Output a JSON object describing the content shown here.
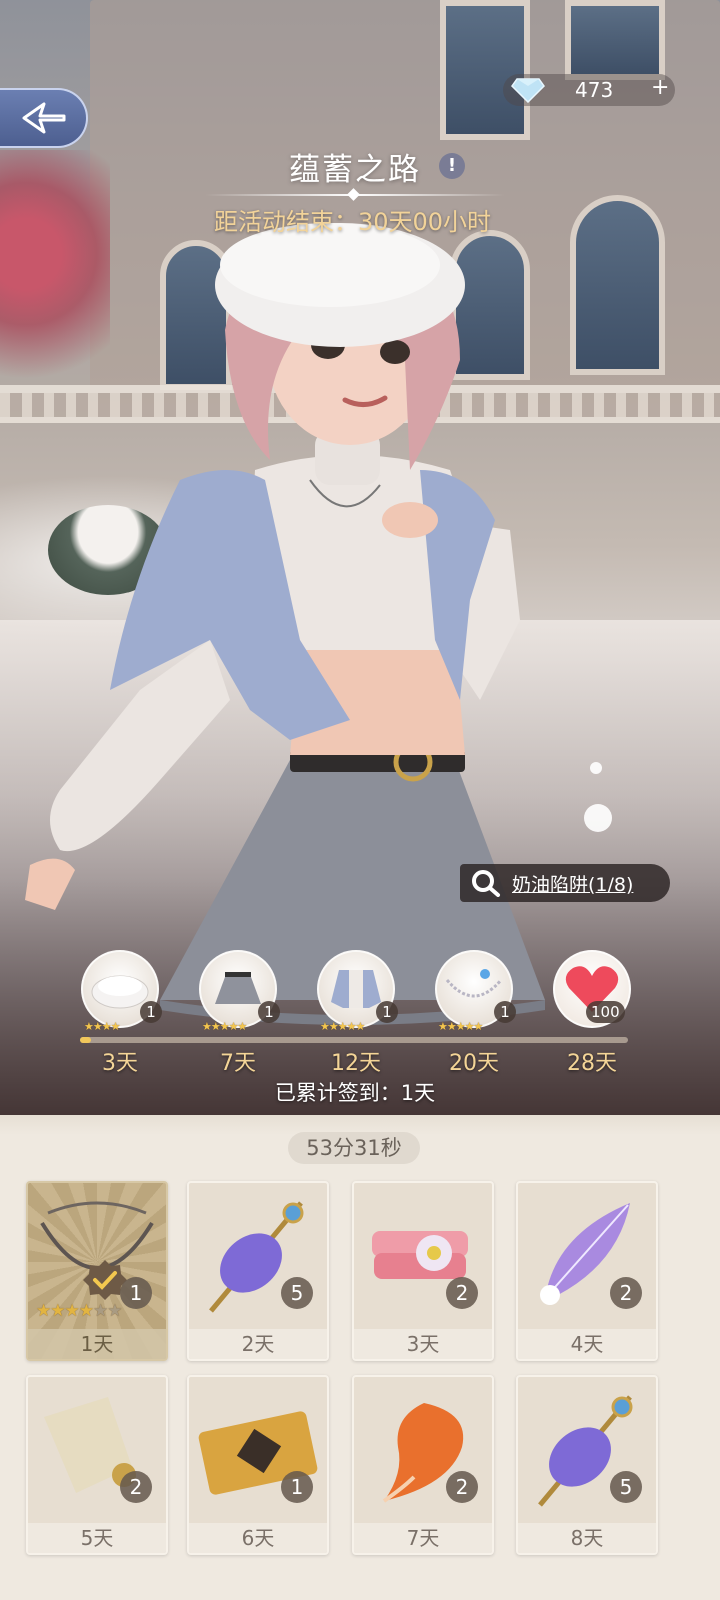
{
  "header": {
    "back_icon": "back-arrow-icon",
    "currency": {
      "icon": "diamond-icon",
      "amount": "473",
      "plus": "+"
    },
    "title": "蕴蓄之路",
    "info_icon": "!",
    "countdown": "距活动结束：30天00小时"
  },
  "item_hint": {
    "icon": "search-icon",
    "text": "奶油陷阱(1/8)"
  },
  "reward_track": {
    "progress": 0.02,
    "rewards": [
      {
        "item": "white-beret",
        "count": "1",
        "day": "3天"
      },
      {
        "item": "grey-skirt",
        "count": "1",
        "day": "7天"
      },
      {
        "item": "blue-cardigan",
        "count": "1",
        "day": "12天"
      },
      {
        "item": "necklace",
        "count": "1",
        "day": "20天"
      },
      {
        "item": "heart",
        "count": "100",
        "day": "28天"
      }
    ],
    "cumulative": "已累计签到：1天"
  },
  "panel": {
    "timer": "53分31秒",
    "cards": [
      {
        "item": "necklace",
        "qty": "1",
        "day": "1天",
        "claimed": true,
        "stars": 4
      },
      {
        "item": "purple-yarn-spindle",
        "qty": "5",
        "day": "2天"
      },
      {
        "item": "pink-fabric-flower",
        "qty": "2",
        "day": "3天"
      },
      {
        "item": "purple-feather",
        "qty": "2",
        "day": "4天"
      },
      {
        "item": "silk-scroll",
        "qty": "2",
        "day": "5天"
      },
      {
        "item": "golden-ticket",
        "qty": "1",
        "day": "6天"
      },
      {
        "item": "orange-fur",
        "qty": "2",
        "day": "7天"
      },
      {
        "item": "purple-yarn-spindle",
        "qty": "5",
        "day": "8天"
      }
    ]
  },
  "colors": {
    "accent_gold": "#f2d399",
    "panel_bg": "#efe9e0",
    "star": "#e2b441"
  }
}
